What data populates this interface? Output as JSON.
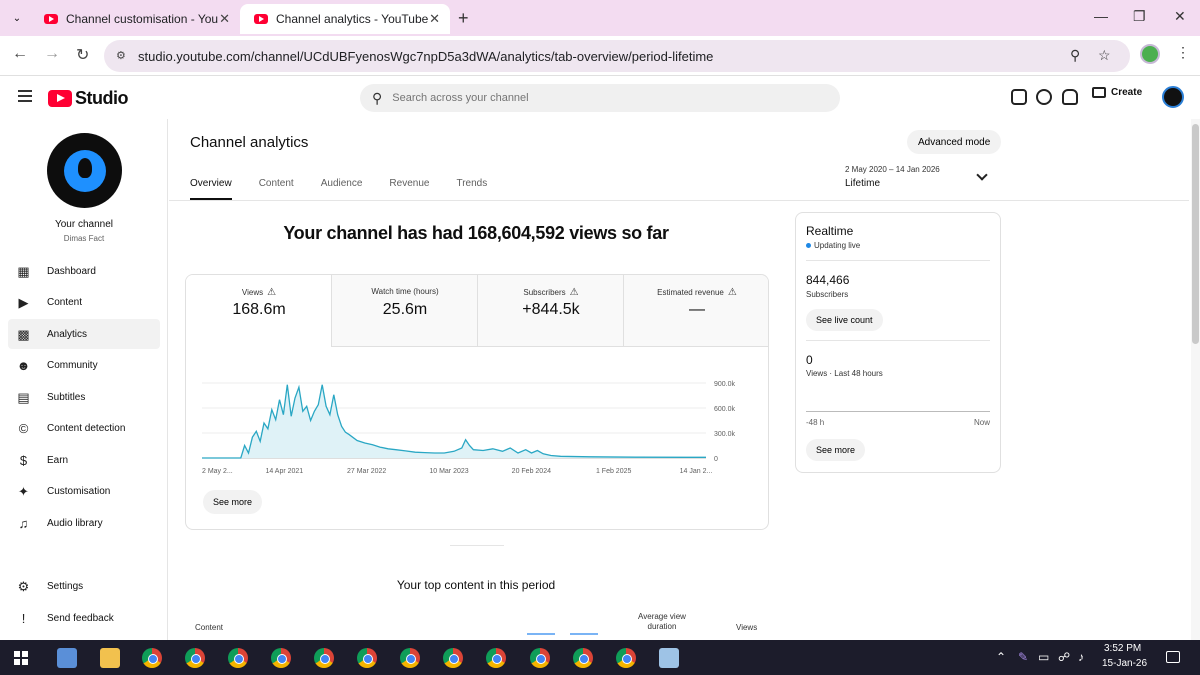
{
  "browser": {
    "tabs": [
      {
        "title": "Channel customisation - YouTube Studio",
        "active": false
      },
      {
        "title": "Channel analytics - YouTube Studio",
        "active": true
      }
    ],
    "url": "studio.youtube.com/channel/UCdUBFyenosWgc7npD5a3dWA/analytics/tab-overview/period-lifetime"
  },
  "studio": {
    "logo_text": "Studio",
    "search_placeholder": "Search across your channel",
    "create_label": "Create"
  },
  "sidebar": {
    "channel_label": "Your channel",
    "channel_name": "Dimas Fact",
    "items": [
      {
        "label": "Dashboard",
        "icon": "dashboard-icon"
      },
      {
        "label": "Content",
        "icon": "content-icon"
      },
      {
        "label": "Analytics",
        "icon": "analytics-icon",
        "active": true
      },
      {
        "label": "Community",
        "icon": "community-icon"
      },
      {
        "label": "Subtitles",
        "icon": "subtitles-icon"
      },
      {
        "label": "Content detection",
        "icon": "copyright-icon"
      },
      {
        "label": "Earn",
        "icon": "dollar-icon"
      },
      {
        "label": "Customisation",
        "icon": "wand-icon"
      },
      {
        "label": "Audio library",
        "icon": "audio-library-icon"
      }
    ],
    "bottom_items": [
      {
        "label": "Settings",
        "icon": "gear-icon"
      },
      {
        "label": "Send feedback",
        "icon": "feedback-icon"
      }
    ]
  },
  "main": {
    "title": "Channel analytics",
    "advanced_mode": "Advanced mode",
    "period_range": "2 May 2020 – 14 Jan 2026",
    "period_name": "Lifetime",
    "tabs": [
      "Overview",
      "Content",
      "Audience",
      "Revenue",
      "Trends"
    ],
    "headline": "Your channel has had 168,604,592 views so far",
    "metrics": [
      {
        "label": "Views",
        "value": "168.6m"
      },
      {
        "label": "Watch time (hours)",
        "value": "25.6m"
      },
      {
        "label": "Subscribers",
        "value": "+844.5k"
      },
      {
        "label": "Estimated revenue",
        "value": "—"
      }
    ],
    "see_more": "See more",
    "top_content_title": "Your top content in this period",
    "table_headers": {
      "content": "Content",
      "avd_line1": "Average view",
      "avd_line2": "duration",
      "views": "Views"
    }
  },
  "chart_data": {
    "type": "area",
    "series": [
      {
        "values": [
          [
            0,
            0
          ],
          [
            40,
            0
          ],
          [
            44,
            150000
          ],
          [
            48,
            60000
          ],
          [
            52,
            250000
          ],
          [
            56,
            320000
          ],
          [
            60,
            200000
          ],
          [
            64,
            420000
          ],
          [
            68,
            350000
          ],
          [
            72,
            580000
          ],
          [
            76,
            460000
          ],
          [
            80,
            700000
          ],
          [
            84,
            520000
          ],
          [
            88,
            880000
          ],
          [
            92,
            500000
          ],
          [
            96,
            720000
          ],
          [
            100,
            850000
          ],
          [
            104,
            560000
          ],
          [
            108,
            620000
          ],
          [
            112,
            450000
          ],
          [
            116,
            560000
          ],
          [
            120,
            640000
          ],
          [
            124,
            880000
          ],
          [
            128,
            620000
          ],
          [
            132,
            520000
          ],
          [
            136,
            760000
          ],
          [
            140,
            520000
          ],
          [
            144,
            380000
          ],
          [
            148,
            310000
          ],
          [
            152,
            280000
          ],
          [
            160,
            210000
          ],
          [
            168,
            180000
          ],
          [
            176,
            160000
          ],
          [
            184,
            130000
          ],
          [
            192,
            110000
          ],
          [
            200,
            100000
          ],
          [
            210,
            85000
          ],
          [
            220,
            70000
          ],
          [
            230,
            65000
          ],
          [
            240,
            60000
          ],
          [
            250,
            60000
          ],
          [
            260,
            80000
          ],
          [
            268,
            120000
          ],
          [
            272,
            220000
          ],
          [
            276,
            150000
          ],
          [
            280,
            100000
          ],
          [
            290,
            90000
          ],
          [
            300,
            110000
          ],
          [
            310,
            80000
          ],
          [
            318,
            120000
          ],
          [
            326,
            60000
          ],
          [
            334,
            100000
          ],
          [
            340,
            60000
          ],
          [
            346,
            90000
          ],
          [
            352,
            50000
          ],
          [
            360,
            30000
          ],
          [
            370,
            20000
          ],
          [
            400,
            15000
          ],
          [
            450,
            10000
          ],
          [
            500,
            9000
          ],
          [
            520,
            8000
          ]
        ]
      }
    ],
    "x_ticks": [
      "2 May 2...",
      "14 Apr 2021",
      "27 Mar 2022",
      "10 Mar 2023",
      "20 Feb 2024",
      "1 Feb 2025",
      "14 Jan 2..."
    ],
    "y_ticks": [
      "900.0k",
      "600.0k",
      "300.0k",
      "0"
    ],
    "ylim": [
      0,
      900000
    ],
    "xlim": [
      0,
      520
    ]
  },
  "realtime": {
    "title": "Realtime",
    "live_label": "Updating live",
    "subscribers": "844,466",
    "subscribers_label": "Subscribers",
    "see_live_count": "See live count",
    "views": "0",
    "views_label": "Views · Last 48 hours",
    "axis_left": "-48 h",
    "axis_right": "Now",
    "see_more": "See more"
  },
  "taskbar": {
    "time": "3:52 PM",
    "date": "15-Jan-26"
  }
}
